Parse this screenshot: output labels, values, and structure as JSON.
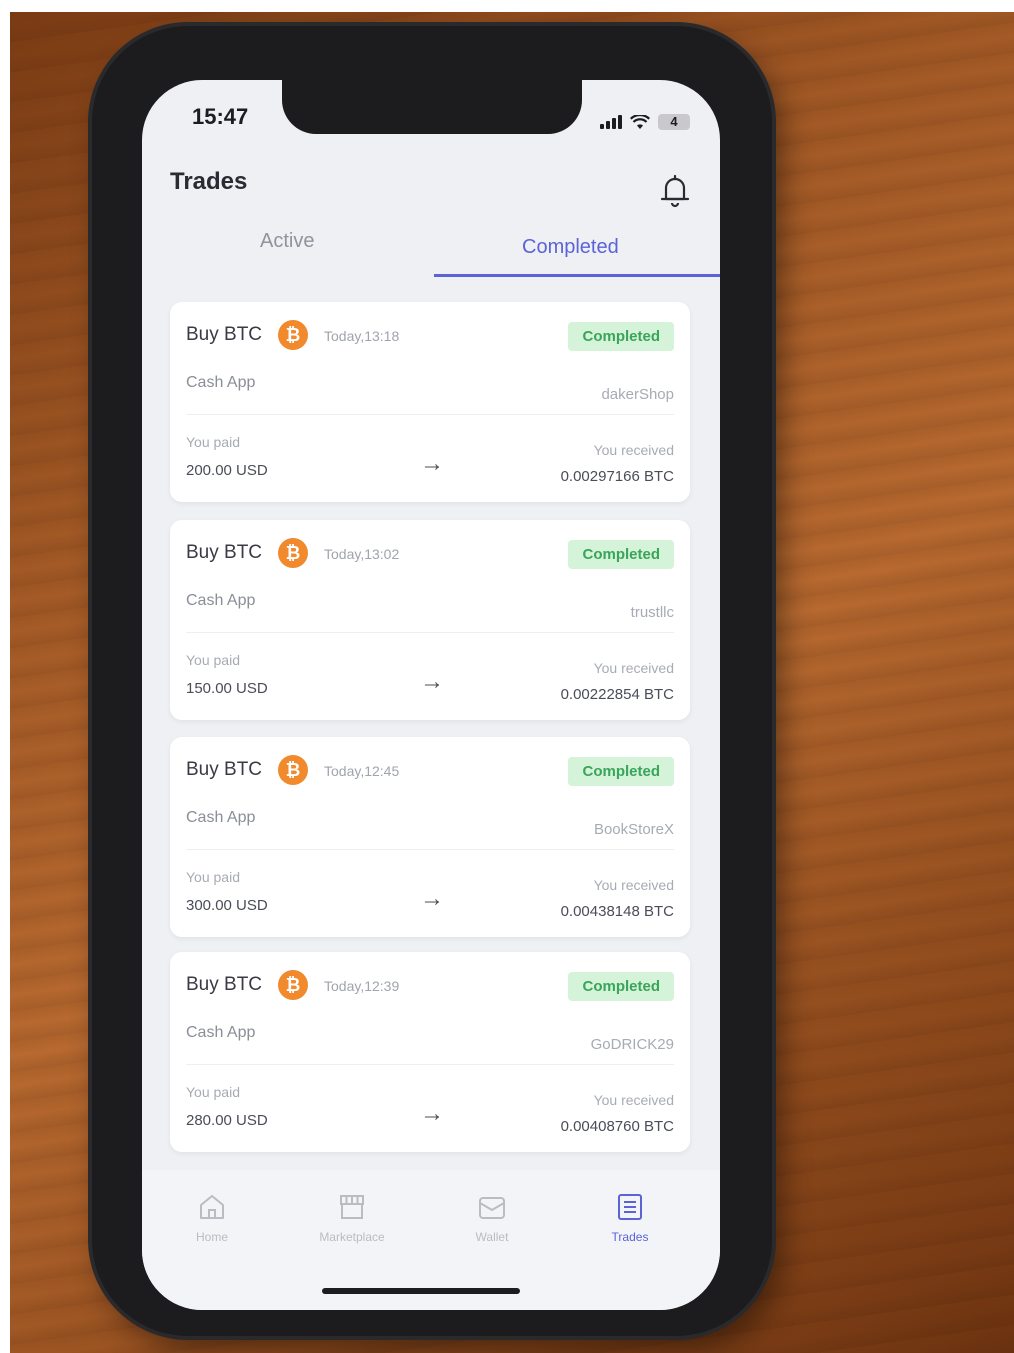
{
  "status_bar": {
    "time": "15:47",
    "battery": "4"
  },
  "header": {
    "title": "Trades"
  },
  "tabs": [
    {
      "label": "Active"
    },
    {
      "label": "Completed"
    }
  ],
  "trades": [
    {
      "type": "Buy BTC",
      "coin": "₿",
      "time": "Today,13:18",
      "status": "Completed",
      "method": "Cash App",
      "counterparty": "dakerShop",
      "paid_label": "You paid",
      "paid": "200.00 USD",
      "received_label": "You received",
      "received": "0.00297166 BTC"
    },
    {
      "type": "Buy BTC",
      "coin": "₿",
      "time": "Today,13:02",
      "status": "Completed",
      "method": "Cash App",
      "counterparty": "trustllc",
      "paid_label": "You paid",
      "paid": "150.00 USD",
      "received_label": "You received",
      "received": "0.00222854 BTC"
    },
    {
      "type": "Buy BTC",
      "coin": "₿",
      "time": "Today,12:45",
      "status": "Completed",
      "method": "Cash App",
      "counterparty": "BookStoreX",
      "paid_label": "You paid",
      "paid": "300.00 USD",
      "received_label": "You received",
      "received": "0.00438148 BTC"
    },
    {
      "type": "Buy BTC",
      "coin": "₿",
      "time": "Today,12:39",
      "status": "Completed",
      "method": "Cash App",
      "counterparty": "GoDRICK29",
      "paid_label": "You paid",
      "paid": "280.00 USD",
      "received_label": "You received",
      "received": "0.00408760 BTC"
    }
  ],
  "bottom_nav": [
    {
      "label": "Home",
      "icon": "home-icon"
    },
    {
      "label": "Marketplace",
      "icon": "store-icon"
    },
    {
      "label": "Wallet",
      "icon": "wallet-icon"
    },
    {
      "label": "Trades",
      "icon": "list-icon"
    }
  ],
  "colors": {
    "accent": "#5b63d6",
    "status_bg": "#d4f3d9",
    "status_text": "#3aa55a",
    "coin": "#f08a2c"
  }
}
